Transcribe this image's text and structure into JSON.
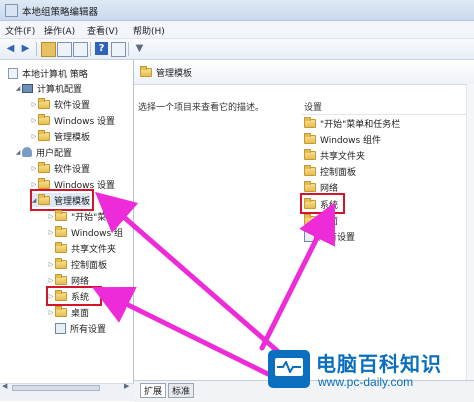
{
  "window": {
    "title": "本地组策略编辑器"
  },
  "menu": [
    "文件(F)",
    "操作(A)",
    "查看(V)",
    "帮助(H)"
  ],
  "toolbar": [
    "back-arrow-icon",
    "forward-arrow-icon",
    "up-folder-icon",
    "show-hide-tree-icon",
    "export-list-icon",
    "help-icon",
    "properties-icon",
    "filter-icon"
  ],
  "tree": {
    "root": "本地计算机 策略",
    "computer": {
      "label": "计算机配置",
      "children": [
        "软件设置",
        "Windows 设置",
        "管理模板"
      ]
    },
    "user": {
      "label": "用户配置",
      "children": [
        "软件设置",
        "Windows 设置"
      ],
      "admin_templates": {
        "label": "管理模板",
        "children": [
          "\"开始\"菜",
          "Windows 组",
          "共享文件夹",
          "控制面板",
          "网络",
          "系统",
          "桌面",
          "所有设置"
        ]
      }
    }
  },
  "right": {
    "header": "管理模板",
    "description": "选择一个项目来查看它的描述。",
    "column": "设置",
    "items": [
      "\"开始\"菜单和任务栏",
      "Windows 组件",
      "共享文件夹",
      "控制面板",
      "网络",
      "系统",
      "桌面",
      "所有设置"
    ]
  },
  "tabs": [
    "扩展",
    "标准"
  ],
  "logo": {
    "title": "电脑百科知识",
    "url": "www.pc-daily.com"
  },
  "colors": {
    "highlight": "#d2152b",
    "arrow": "#ee2bd8",
    "brand": "#0b6fbf"
  }
}
